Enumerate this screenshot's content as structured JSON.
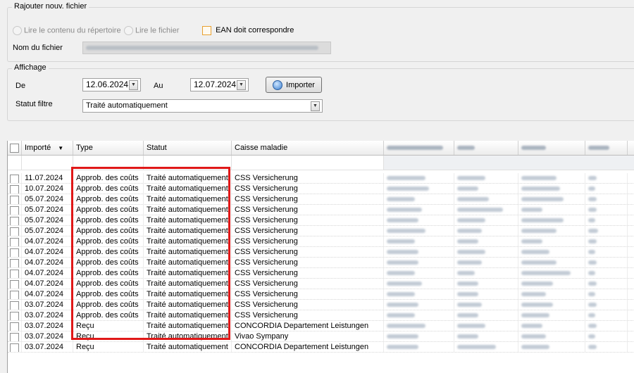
{
  "add_file": {
    "title": "Rajouter nouv. fichier",
    "radio_directory": "Lire le contenu du répertoire",
    "radio_file": "Lire le fichier",
    "ean_label": "EAN doit correspondre",
    "filename_label": "Nom du fichier"
  },
  "display": {
    "title": "Affichage",
    "from_label": "De",
    "from_value": "12.06.2024",
    "to_label": "Au",
    "to_value": "12.07.2024",
    "import_button": "Importer",
    "status_filter_label": "Statut filtre",
    "status_filter_value": "Traité automatiquement"
  },
  "grid": {
    "headers": [
      "Importé",
      "Type",
      "Statut",
      "Caisse maladie"
    ],
    "rows": [
      {
        "imported": "11.07.2024",
        "type": "Approb. des coûts",
        "status": "Traité automatiquement",
        "insurer": "CSS Versicherung"
      },
      {
        "imported": "10.07.2024",
        "type": "Approb. des coûts",
        "status": "Traité automatiquement",
        "insurer": "CSS Versicherung"
      },
      {
        "imported": "05.07.2024",
        "type": "Approb. des coûts",
        "status": "Traité automatiquement",
        "insurer": "CSS Versicherung"
      },
      {
        "imported": "05.07.2024",
        "type": "Approb. des coûts",
        "status": "Traité automatiquement",
        "insurer": "CSS Versicherung"
      },
      {
        "imported": "05.07.2024",
        "type": "Approb. des coûts",
        "status": "Traité automatiquement",
        "insurer": "CSS Versicherung"
      },
      {
        "imported": "05.07.2024",
        "type": "Approb. des coûts",
        "status": "Traité automatiquement",
        "insurer": "CSS Versicherung"
      },
      {
        "imported": "04.07.2024",
        "type": "Approb. des coûts",
        "status": "Traité automatiquement",
        "insurer": "CSS Versicherung"
      },
      {
        "imported": "04.07.2024",
        "type": "Approb. des coûts",
        "status": "Traité automatiquement",
        "insurer": "CSS Versicherung"
      },
      {
        "imported": "04.07.2024",
        "type": "Approb. des coûts",
        "status": "Traité automatiquement",
        "insurer": "CSS Versicherung"
      },
      {
        "imported": "04.07.2024",
        "type": "Approb. des coûts",
        "status": "Traité automatiquement",
        "insurer": "CSS Versicherung"
      },
      {
        "imported": "04.07.2024",
        "type": "Approb. des coûts",
        "status": "Traité automatiquement",
        "insurer": "CSS Versicherung"
      },
      {
        "imported": "04.07.2024",
        "type": "Approb. des coûts",
        "status": "Traité automatiquement",
        "insurer": "CSS Versicherung"
      },
      {
        "imported": "03.07.2024",
        "type": "Approb. des coûts",
        "status": "Traité automatiquement",
        "insurer": "CSS Versicherung"
      },
      {
        "imported": "03.07.2024",
        "type": "Approb. des coûts",
        "status": "Traité automatiquement",
        "insurer": "CSS Versicherung"
      },
      {
        "imported": "03.07.2024",
        "type": "Reçu",
        "status": "Traité automatiquement",
        "insurer": "CONCORDIA Departement Leistungen"
      },
      {
        "imported": "03.07.2024",
        "type": "Reçu",
        "status": "Traité automatiquement",
        "insurer": "Vivao Sympany"
      },
      {
        "imported": "03.07.2024",
        "type": "Reçu",
        "status": "Traité automatiquement",
        "insurer": "CONCORDIA Departement Leistungen"
      }
    ]
  }
}
